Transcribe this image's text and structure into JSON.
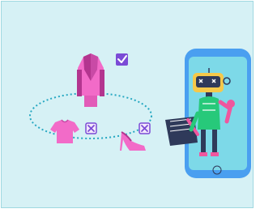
{
  "scene": {
    "background_color": "#d6f1f5",
    "border_color": "#9fd8e0",
    "items": [
      {
        "name": "jacket",
        "status": "selected",
        "icon": "check-icon"
      },
      {
        "name": "tshirt",
        "status": "rejected",
        "icon": "x-icon"
      },
      {
        "name": "high-heel",
        "status": "rejected",
        "icon": "x-icon"
      }
    ],
    "colors": {
      "garment_pink": "#f26bc8",
      "garment_dark": "#b3358f",
      "check_purple": "#7b4bd6",
      "dotted_teal": "#27a8c2",
      "phone_blue": "#4a9ff0",
      "phone_screen": "#7dd9e8",
      "robot_green": "#27c97a",
      "robot_pink": "#f0569e",
      "robot_dark": "#2f3a5a"
    }
  }
}
